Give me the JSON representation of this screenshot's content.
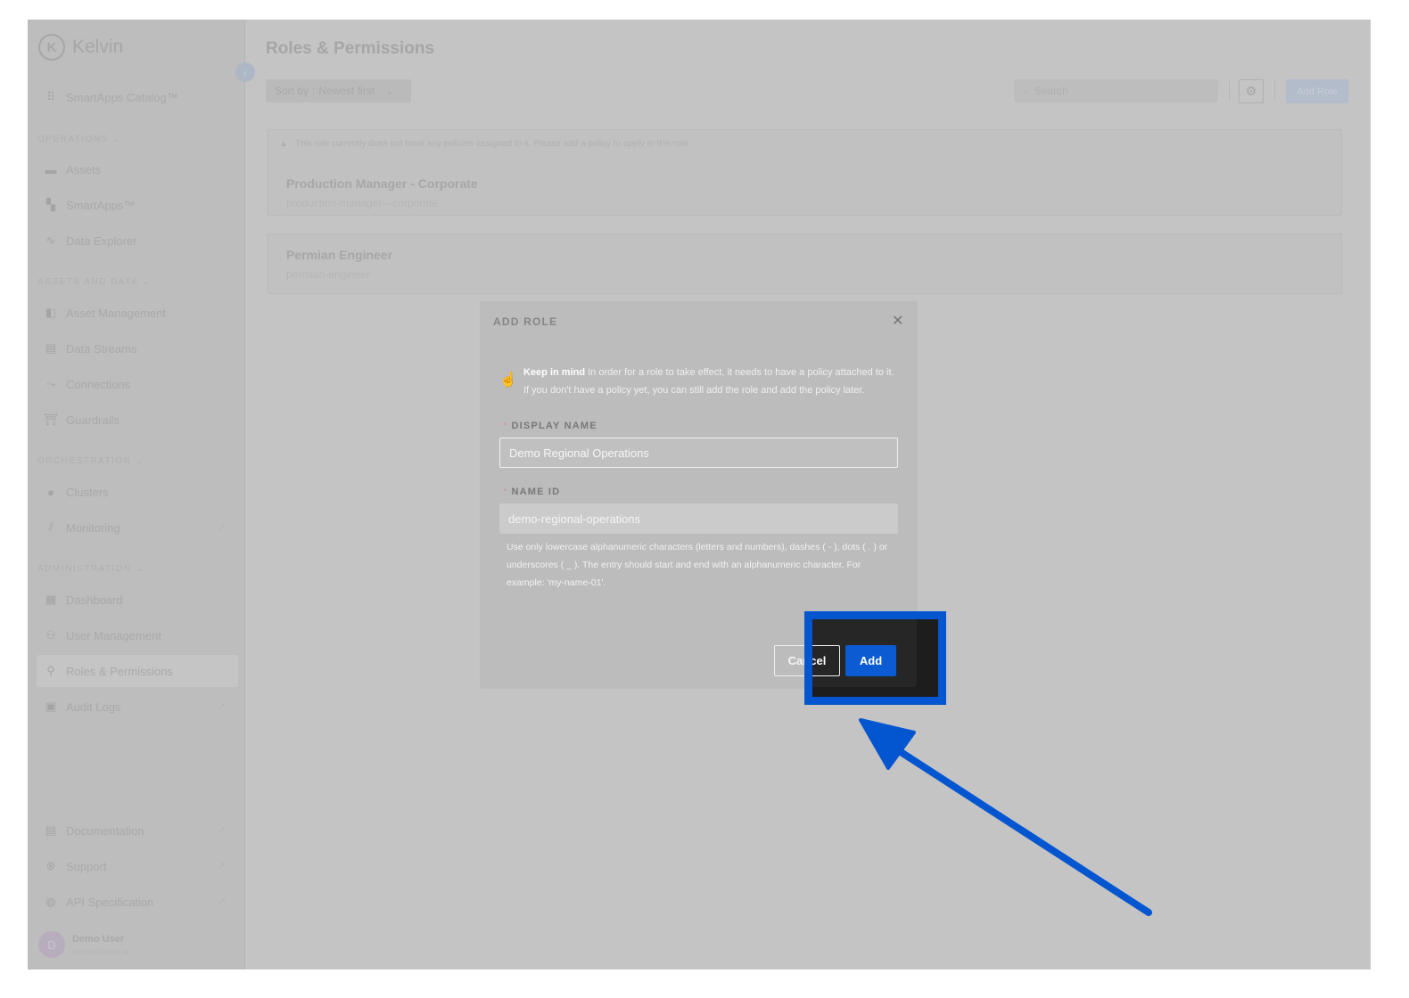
{
  "app": {
    "logo_letter": "K",
    "logo_text": "Kelvin",
    "collapse_glyph": "‹"
  },
  "sidebar": {
    "catalog": "SmartApps Catalog™",
    "sections": {
      "operations": "OPERATIONS ⌄",
      "assets_and_data": "ASSETS AND DATA ⌄",
      "orchestration": "ORCHESTRATION ⌄",
      "administration": "ADMINISTRATION ⌄"
    },
    "items": {
      "assets": "Assets",
      "smartapps": "SmartApps™",
      "data_explorer": "Data Explorer",
      "asset_management": "Asset Management",
      "data_streams": "Data Streams",
      "connections": "Connections",
      "guardrails": "Guardrails",
      "clusters": "Clusters",
      "monitoring": "Monitoring",
      "dashboard": "Dashboard",
      "user_management": "User Management",
      "roles_permissions": "Roles & Permissions",
      "audit_logs": "Audit Logs",
      "documentation": "Documentation",
      "support": "Support",
      "api_specification": "API Specification"
    },
    "external_glyph": "↗",
    "user": {
      "initial": "D",
      "name": "Demo User",
      "email": "demo@kelvin.ai"
    }
  },
  "main": {
    "title": "Roles & Permissions",
    "sort_label": "Sort by",
    "sort_value": "Newest first",
    "search_placeholder": "Search",
    "add_role": "Add Role",
    "warning": "This role currently does not have any policies assigned to it. Please add a policy to apply to this role.",
    "roles": [
      {
        "name": "Production Manager - Corporate",
        "id": "production-manager---corporate"
      },
      {
        "name": "Permian Engineer",
        "id": "permian-engineer"
      }
    ]
  },
  "modal": {
    "title": "ADD ROLE",
    "close": "✕",
    "info_bold": "Keep in mind",
    "info_text": " In order for a role to take effect, it needs to have a policy attached to it. If you don't have a policy yet, you can still add the role and add the policy later.",
    "required_mark": "*",
    "display_name_label": "DISPLAY NAME",
    "display_name_value": "Demo Regional Operations",
    "name_id_label": "NAME ID",
    "name_id_value": "demo-regional-operations",
    "hint": "Use only lowercase alphanumeric characters (letters and numbers), dashes ( - ), dots ( . ) or underscores ( _ ). The entry should start and end with an alphanumeric character. For example: 'my-name-01'.",
    "cancel": "Cancel",
    "add": "Add"
  },
  "colors": {
    "highlight": "#0455d0",
    "primary_button": "#0b5bd3",
    "overlay": "#c4c4c4"
  }
}
